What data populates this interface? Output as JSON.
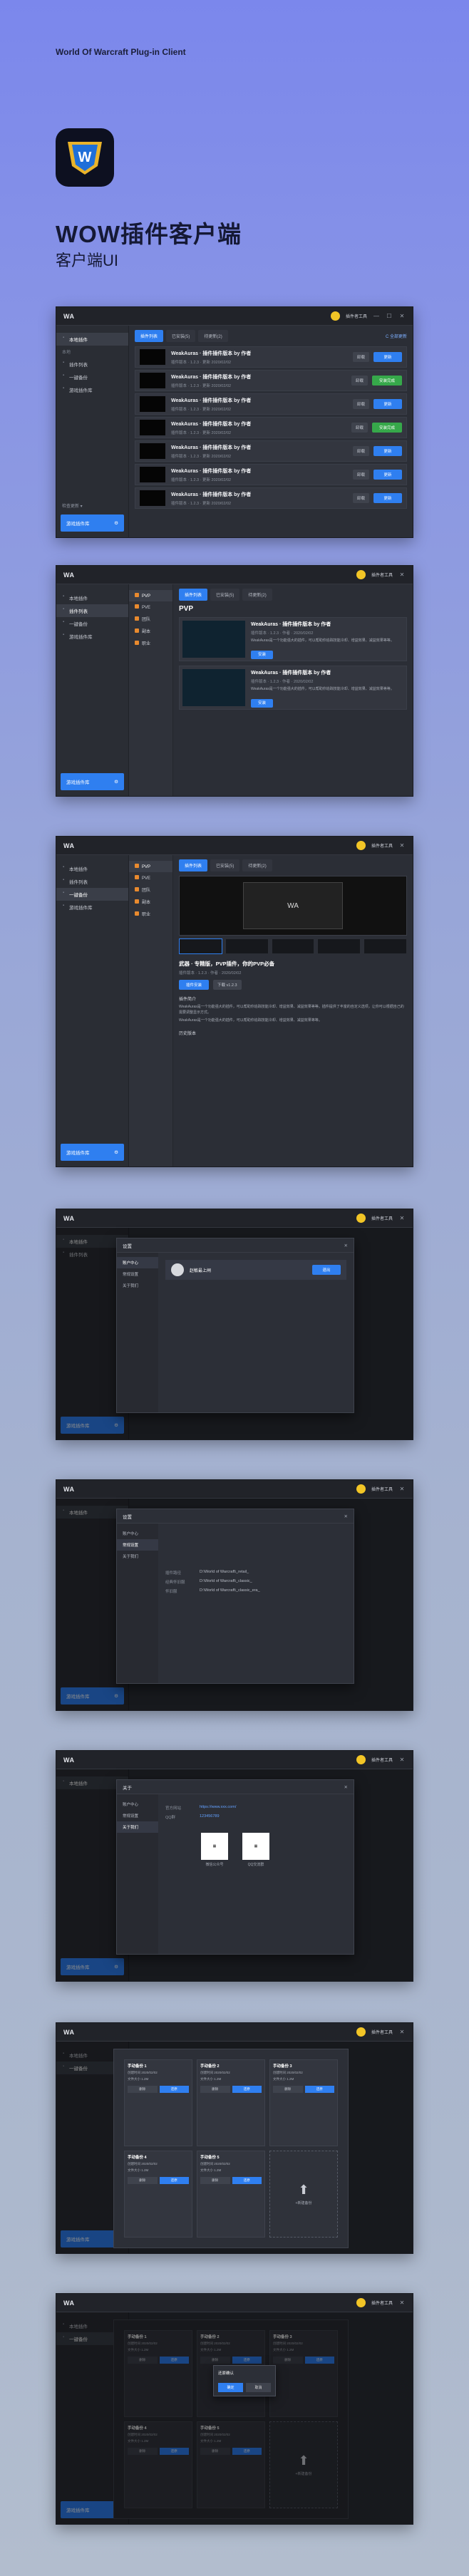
{
  "hero": {
    "eyebrow": "World Of Warcraft Plug-in Client",
    "title": "WOW插件客户端",
    "subtitle": "客户端UI",
    "logo_icon": "wow-shield-logo"
  },
  "app": {
    "logo_text": "WA",
    "user_name": "插件者工具",
    "controls": [
      "—",
      "☐",
      "✕"
    ]
  },
  "sidebar": {
    "section_local": "本地",
    "items": [
      "本地插件",
      "插件列表",
      "一键备份",
      "游戏插件库"
    ],
    "bottom_link": "检查更新 ▾",
    "cta_label": "游戏插件库",
    "cta_icon": "gear-icon"
  },
  "tabs": [
    "插件列表",
    "已安装(5)",
    "待更新(2)"
  ],
  "refresh_label": "C 全部更新",
  "plugin_rows": [
    {
      "title": "WeakAuras · 插件插件版本 by 作者",
      "meta": "插件版本 · 1.2.3 · 更新 2020/02/02",
      "secondary": "卸载",
      "primary": "更新",
      "primary_style": "blue"
    },
    {
      "title": "WeakAuras · 插件插件版本 by 作者",
      "meta": "插件版本 · 1.2.3 · 更新 2020/02/02",
      "secondary": "卸载",
      "primary": "安装完成",
      "primary_style": "green"
    },
    {
      "title": "WeakAuras · 插件插件版本 by 作者",
      "meta": "插件版本 · 1.2.3 · 更新 2020/02/02",
      "secondary": "卸载",
      "primary": "更新",
      "primary_style": "blue"
    },
    {
      "title": "WeakAuras · 插件插件版本 by 作者",
      "meta": "插件版本 · 1.2.3 · 更新 2020/02/02",
      "secondary": "卸载",
      "primary": "安装完成",
      "primary_style": "green"
    },
    {
      "title": "WeakAuras · 插件插件版本 by 作者",
      "meta": "插件版本 · 1.2.3 · 更新 2020/02/02",
      "secondary": "卸载",
      "primary": "更新",
      "primary_style": "blue"
    },
    {
      "title": "WeakAuras · 插件插件版本 by 作者",
      "meta": "插件版本 · 1.2.3 · 更新 2020/02/02",
      "secondary": "卸载",
      "primary": "更新",
      "primary_style": "blue"
    },
    {
      "title": "WeakAuras · 插件插件版本 by 作者",
      "meta": "插件版本 · 1.2.3 · 更新 2020/02/02",
      "secondary": "卸载",
      "primary": "更新",
      "primary_style": "blue"
    }
  ],
  "categories": [
    "PVP",
    "PVE",
    "团队",
    "副本",
    "职业"
  ],
  "category_title": "PVP",
  "cards": [
    {
      "title": "WeakAuras · 插件插件版本 by 作者",
      "meta": "插件版本 · 1.2.3 · 作者 · 2020/02/02",
      "desc": "WeakAuras是一个功能强大的插件，可以帮助你追踪技能冷却、增益效果、减益效果等等。",
      "btn": "安装"
    },
    {
      "title": "WeakAuras · 插件插件版本 by 作者",
      "meta": "插件版本 · 1.2.3 · 作者 · 2020/02/02",
      "desc": "WeakAuras是一个功能强大的插件，可以帮助你追踪技能冷却、增益效果、减益效果等等。",
      "btn": "安装"
    }
  ],
  "detail": {
    "title": "武器 · 专精版，PVP插件，你的PVP必备",
    "meta": "插件版本 · 1.2.3 · 作者 · 2020/02/02",
    "install": "插件安装",
    "download": "下载 v1.2.3",
    "section_desc": "插件简介",
    "para1": "WeakAuras是一个功能强大的插件，可以帮助你追踪技能冷却、增益效果、减益效果等等。插件提供了丰富的自定义选项，让你可以根据自己的需要调整显示方式。",
    "para2": "WeakAuras是一个功能强大的插件，可以帮助你追踪技能冷却、增益效果、减益效果等等。",
    "section_versions": "历史版本"
  },
  "dialog_user": {
    "title": "设置",
    "nav": [
      "账户中心",
      "常规设置",
      "关于我们"
    ],
    "user_name": "赵敏最上闸",
    "btn": "退出"
  },
  "dialog_settings": {
    "title": "设置",
    "rows": [
      {
        "k": "插件路径",
        "v": "D:\\World of Warcraft\\_retail_"
      },
      {
        "k": "经典怀旧服",
        "v": "D:\\World of Warcraft\\_classic_"
      },
      {
        "k": "怀旧服",
        "v": "D:\\World of Warcraft\\_classic_era_"
      }
    ]
  },
  "dialog_about": {
    "title": "关于",
    "site_label": "官方网站",
    "site_url": "https://www.xxx.com/",
    "qq_label": "QQ群",
    "qq_value": "123456789",
    "qr1_caption": "微信公众号",
    "qr2_caption": "QQ交流群"
  },
  "backup_cards": [
    {
      "title": "手动备份 1",
      "lines": [
        "创建时间 2020/02/02",
        "文件大小 1.2M"
      ],
      "btn1": "删除",
      "btn2": "还原"
    },
    {
      "title": "手动备份 2",
      "lines": [
        "创建时间 2020/02/02",
        "文件大小 1.2M"
      ],
      "btn1": "删除",
      "btn2": "还原"
    },
    {
      "title": "手动备份 3",
      "lines": [
        "创建时间 2020/02/02",
        "文件大小 1.2M"
      ],
      "btn1": "删除",
      "btn2": "还原"
    },
    {
      "title": "手动备份 4",
      "lines": [
        "创建时间 2020/02/02",
        "文件大小 1.2M"
      ],
      "btn1": "删除",
      "btn2": "还原"
    },
    {
      "title": "手动备份 5",
      "lines": [
        "创建时间 2020/02/02",
        "文件大小 1.2M"
      ],
      "btn1": "删除",
      "btn2": "还原"
    }
  ],
  "add_backup_label": "+新建备份",
  "confirm_popup": {
    "title": "还原确认",
    "ok": "确定",
    "cancel": "取消"
  }
}
